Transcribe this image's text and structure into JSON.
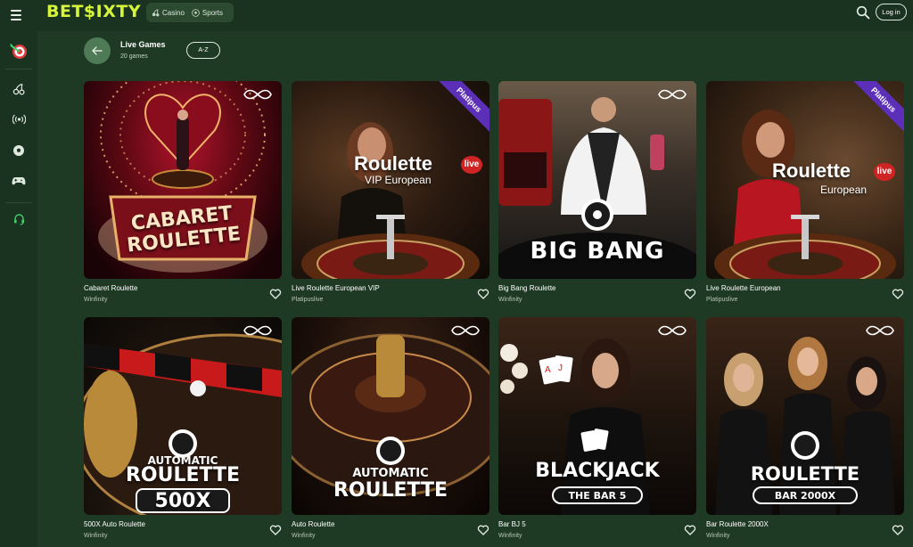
{
  "header": {
    "logo": "BET$IXTY",
    "nav": [
      {
        "label": "Casino",
        "icon": "cherry-icon"
      },
      {
        "label": "Sports",
        "icon": "soccer-ball-icon"
      }
    ],
    "login_label": "Log in"
  },
  "sidebar": {
    "items": [
      {
        "name": "dartboard-icon"
      },
      {
        "name": "cherry-icon"
      },
      {
        "name": "live-signal-icon"
      },
      {
        "name": "soccer-ball-icon"
      },
      {
        "name": "gamepad-icon"
      },
      {
        "name": "headset-icon"
      }
    ]
  },
  "section": {
    "title": "Live Games",
    "count": "20 games",
    "sort_label": "A-Z"
  },
  "games": [
    {
      "name": "Cabaret Roulette",
      "provider": "Winfinity",
      "art": "CABARET ROULETTE"
    },
    {
      "name": "Live Roulette European VIP",
      "provider": "Platipuslive",
      "art": "Roulette",
      "art_sub": "VIP European",
      "ribbon": "Platipus"
    },
    {
      "name": "Big Bang Roulette",
      "provider": "Winfinity",
      "art": "BIG BANG"
    },
    {
      "name": "Live Roulette European",
      "provider": "Platipuslive",
      "art": "Roulette",
      "art_sub": "European",
      "ribbon": "Platipus"
    },
    {
      "name": "500X Auto Roulette",
      "provider": "Winfinity",
      "art": "AUTOMATIC",
      "art_big": "ROULETTE",
      "art_box": "500X"
    },
    {
      "name": "Auto Roulette",
      "provider": "Winfinity",
      "art": "AUTOMATIC",
      "art_big": "ROULETTE"
    },
    {
      "name": "Bar BJ 5",
      "provider": "Winfinity",
      "art_big": "BLACKJACK",
      "art_box": "THE BAR 5"
    },
    {
      "name": "Bar Roulette 2000X",
      "provider": "Winfinity",
      "art_big": "ROULETTE",
      "art_box": "BAR 2000X"
    }
  ],
  "live_badge": "live",
  "colors": {
    "background": "#1f3a24",
    "topbar": "#1a3320",
    "logo": "#d6f53a",
    "back_button": "#4f7a56",
    "ribbon": "#5b2fb8"
  }
}
